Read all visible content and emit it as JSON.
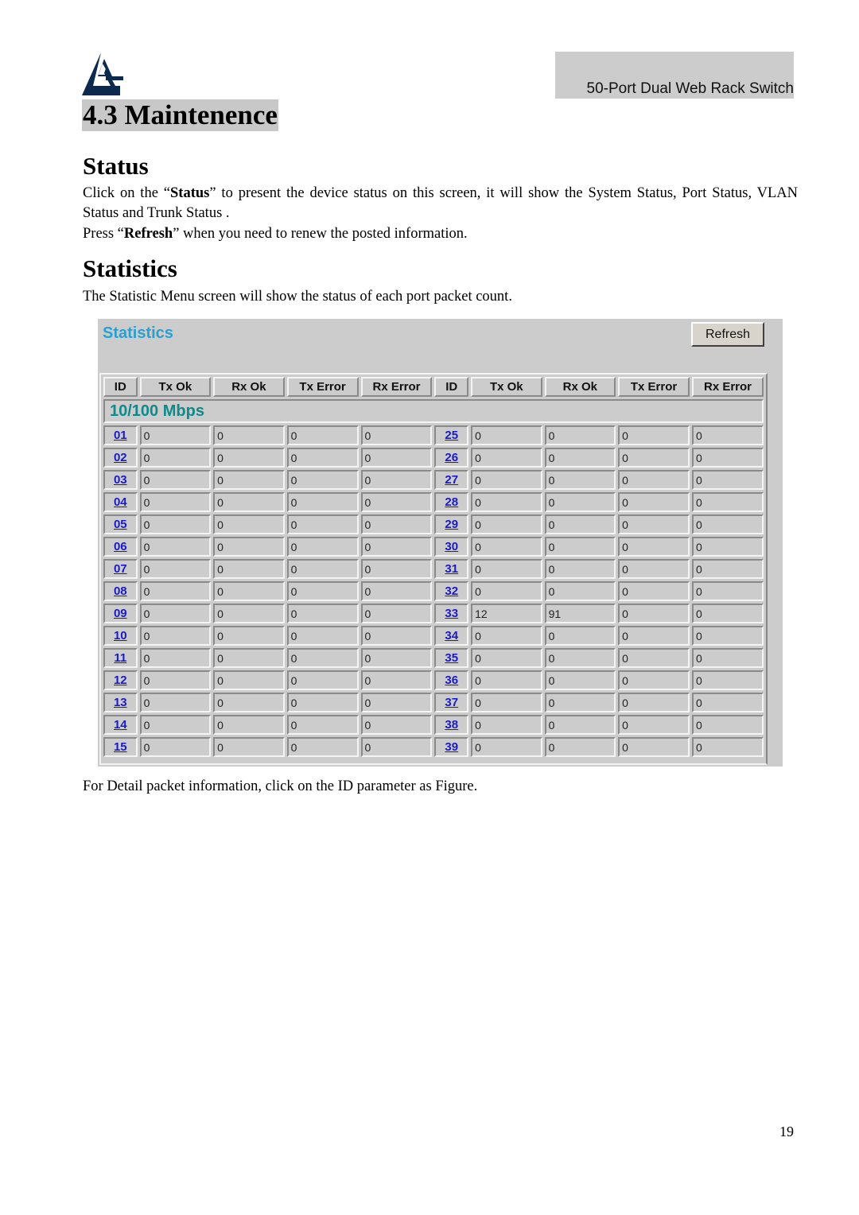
{
  "header": {
    "logo": "atlantis-logo-icon",
    "product": "50-Port Dual Web Rack Switch"
  },
  "section": {
    "title": "4.3 Maintenence"
  },
  "status": {
    "heading": "Status",
    "p1_pre": "Click on the “",
    "p1_bold": "Status",
    "p1_post": "” to present the device status on this screen, it will show the System Status, Port Status, VLAN Status and Trunk Status .",
    "p2_pre": "Press “",
    "p2_bold": "Refresh",
    "p2_post": "” when you need to renew the posted information."
  },
  "statistics": {
    "heading": "Statistics",
    "intro": "The Statistic Menu screen will show the status of each port packet count.",
    "footer": "For Detail packet information, click on the ID parameter as Figure."
  },
  "panel": {
    "title": "Statistics",
    "refresh_label": "Refresh",
    "speed_label": "10/100 Mbps",
    "columns": [
      "ID",
      "Tx Ok",
      "Rx Ok",
      "Tx Error",
      "Rx Error",
      "ID",
      "Tx Ok",
      "Rx Ok",
      "Tx Error",
      "Rx Error"
    ],
    "rows": [
      {
        "left": {
          "id": "01",
          "tx_ok": "0",
          "rx_ok": "0",
          "tx_err": "0",
          "rx_err": "0"
        },
        "right": {
          "id": "25",
          "tx_ok": "0",
          "rx_ok": "0",
          "tx_err": "0",
          "rx_err": "0"
        }
      },
      {
        "left": {
          "id": "02",
          "tx_ok": "0",
          "rx_ok": "0",
          "tx_err": "0",
          "rx_err": "0"
        },
        "right": {
          "id": "26",
          "tx_ok": "0",
          "rx_ok": "0",
          "tx_err": "0",
          "rx_err": "0"
        }
      },
      {
        "left": {
          "id": "03",
          "tx_ok": "0",
          "rx_ok": "0",
          "tx_err": "0",
          "rx_err": "0"
        },
        "right": {
          "id": "27",
          "tx_ok": "0",
          "rx_ok": "0",
          "tx_err": "0",
          "rx_err": "0"
        }
      },
      {
        "left": {
          "id": "04",
          "tx_ok": "0",
          "rx_ok": "0",
          "tx_err": "0",
          "rx_err": "0"
        },
        "right": {
          "id": "28",
          "tx_ok": "0",
          "rx_ok": "0",
          "tx_err": "0",
          "rx_err": "0"
        }
      },
      {
        "left": {
          "id": "05",
          "tx_ok": "0",
          "rx_ok": "0",
          "tx_err": "0",
          "rx_err": "0"
        },
        "right": {
          "id": "29",
          "tx_ok": "0",
          "rx_ok": "0",
          "tx_err": "0",
          "rx_err": "0"
        }
      },
      {
        "left": {
          "id": "06",
          "tx_ok": "0",
          "rx_ok": "0",
          "tx_err": "0",
          "rx_err": "0"
        },
        "right": {
          "id": "30",
          "tx_ok": "0",
          "rx_ok": "0",
          "tx_err": "0",
          "rx_err": "0"
        }
      },
      {
        "left": {
          "id": "07",
          "tx_ok": "0",
          "rx_ok": "0",
          "tx_err": "0",
          "rx_err": "0"
        },
        "right": {
          "id": "31",
          "tx_ok": "0",
          "rx_ok": "0",
          "tx_err": "0",
          "rx_err": "0"
        }
      },
      {
        "left": {
          "id": "08",
          "tx_ok": "0",
          "rx_ok": "0",
          "tx_err": "0",
          "rx_err": "0"
        },
        "right": {
          "id": "32",
          "tx_ok": "0",
          "rx_ok": "0",
          "tx_err": "0",
          "rx_err": "0"
        }
      },
      {
        "left": {
          "id": "09",
          "tx_ok": "0",
          "rx_ok": "0",
          "tx_err": "0",
          "rx_err": "0"
        },
        "right": {
          "id": "33",
          "tx_ok": "12",
          "rx_ok": "91",
          "tx_err": "0",
          "rx_err": "0"
        }
      },
      {
        "left": {
          "id": "10",
          "tx_ok": "0",
          "rx_ok": "0",
          "tx_err": "0",
          "rx_err": "0"
        },
        "right": {
          "id": "34",
          "tx_ok": "0",
          "rx_ok": "0",
          "tx_err": "0",
          "rx_err": "0"
        }
      },
      {
        "left": {
          "id": "11",
          "tx_ok": "0",
          "rx_ok": "0",
          "tx_err": "0",
          "rx_err": "0"
        },
        "right": {
          "id": "35",
          "tx_ok": "0",
          "rx_ok": "0",
          "tx_err": "0",
          "rx_err": "0"
        }
      },
      {
        "left": {
          "id": "12",
          "tx_ok": "0",
          "rx_ok": "0",
          "tx_err": "0",
          "rx_err": "0"
        },
        "right": {
          "id": "36",
          "tx_ok": "0",
          "rx_ok": "0",
          "tx_err": "0",
          "rx_err": "0"
        }
      },
      {
        "left": {
          "id": "13",
          "tx_ok": "0",
          "rx_ok": "0",
          "tx_err": "0",
          "rx_err": "0"
        },
        "right": {
          "id": "37",
          "tx_ok": "0",
          "rx_ok": "0",
          "tx_err": "0",
          "rx_err": "0"
        }
      },
      {
        "left": {
          "id": "14",
          "tx_ok": "0",
          "rx_ok": "0",
          "tx_err": "0",
          "rx_err": "0"
        },
        "right": {
          "id": "38",
          "tx_ok": "0",
          "rx_ok": "0",
          "tx_err": "0",
          "rx_err": "0"
        }
      },
      {
        "left": {
          "id": "15",
          "tx_ok": "0",
          "rx_ok": "0",
          "tx_err": "0",
          "rx_err": "0"
        },
        "right": {
          "id": "39",
          "tx_ok": "0",
          "rx_ok": "0",
          "tx_err": "0",
          "rx_err": "0"
        }
      }
    ],
    "colors": {
      "title": "#2aa0d0",
      "speed": "#0e8a8a",
      "link": "#1a1acc",
      "panel_bg": "#cccccc"
    }
  },
  "page_number": "19"
}
